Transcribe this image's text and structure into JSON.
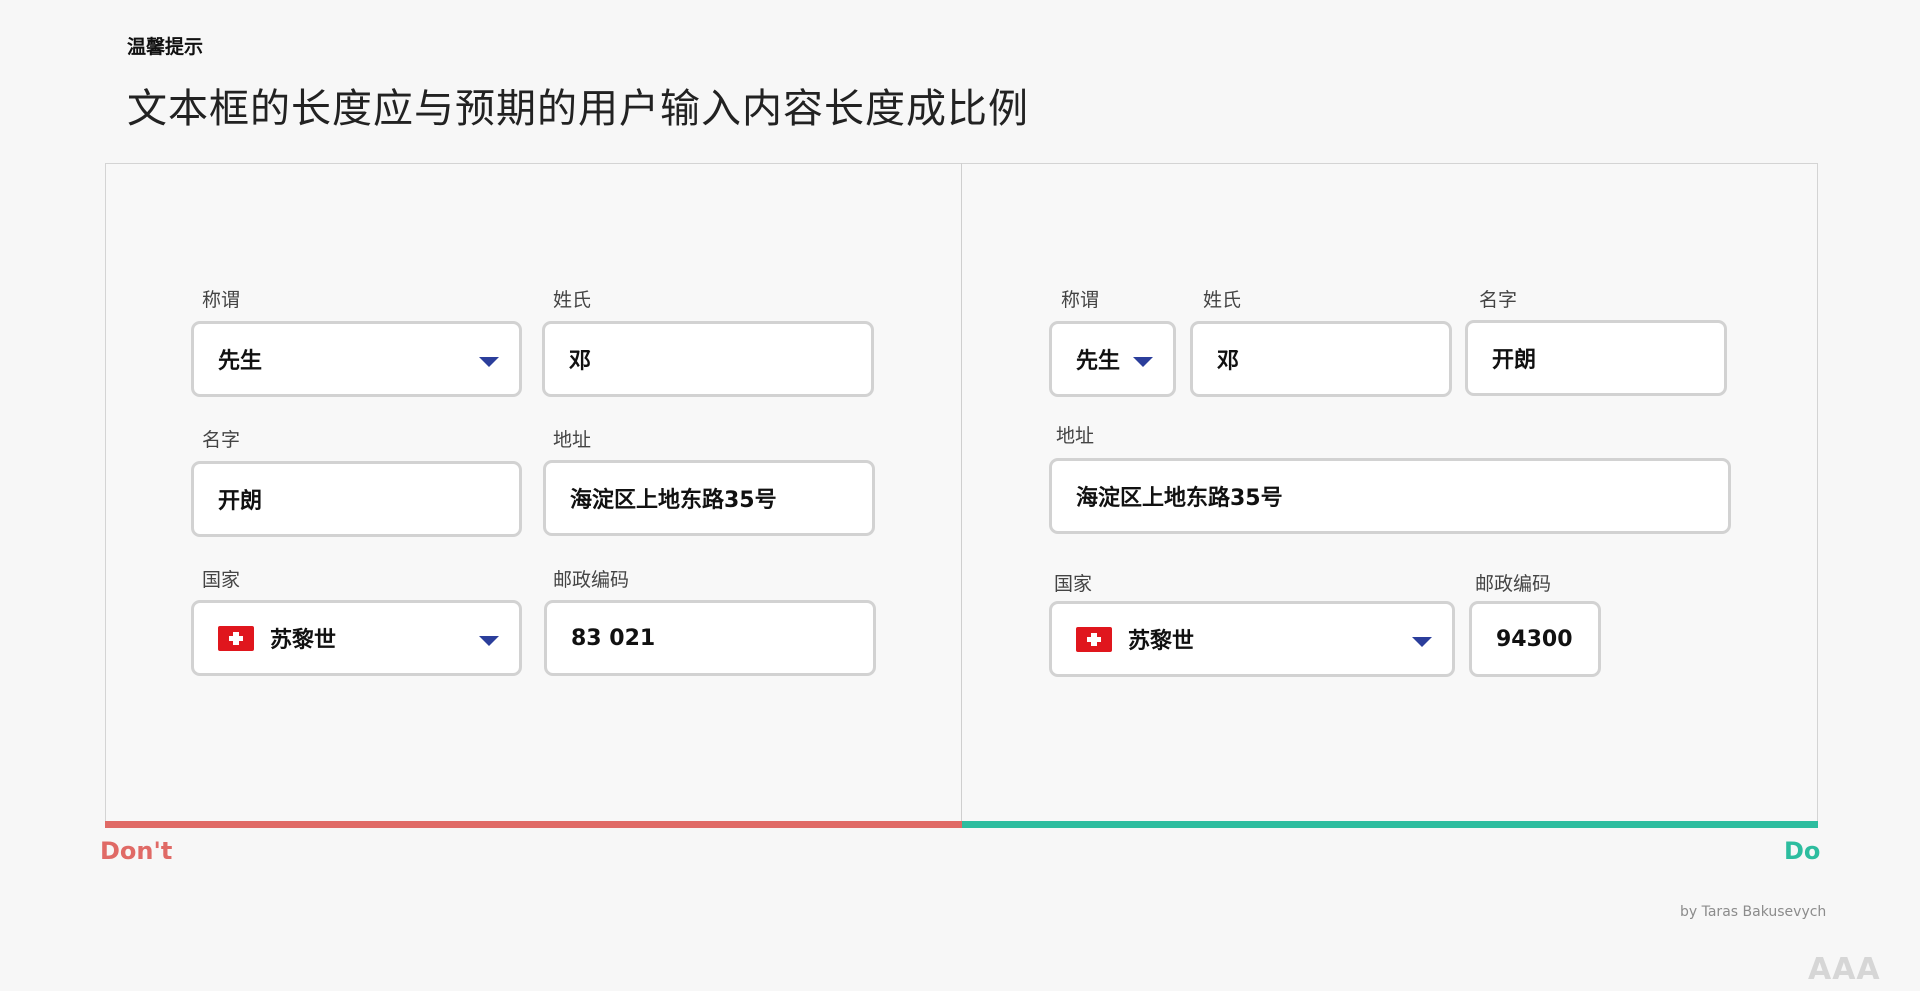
{
  "header": {
    "eyebrow": "温馨提示",
    "title": "文本框的长度应与预期的用户输入内容长度成比例"
  },
  "verdicts": {
    "dont": "Don't",
    "do": "Do"
  },
  "credit": "by Taras Bakusevych",
  "watermark": "AAA",
  "bad_form": {
    "salutation": {
      "label": "称谓",
      "value": "先生",
      "icon": "chevron-down-icon"
    },
    "surname": {
      "label": "姓氏",
      "value": "邓"
    },
    "given_name": {
      "label": "名字",
      "value": "开朗"
    },
    "address": {
      "label": "地址",
      "value": "海淀区上地东路35号"
    },
    "country": {
      "label": "国家",
      "value": "苏黎世",
      "icon": "swiss-flag-icon"
    },
    "postal_code": {
      "label": "邮政编码",
      "value": "83 021"
    }
  },
  "good_form": {
    "salutation": {
      "label": "称谓",
      "value": "先生",
      "icon": "chevron-down-icon"
    },
    "surname": {
      "label": "姓氏",
      "value": "邓"
    },
    "given_name": {
      "label": "名字",
      "value": "开朗"
    },
    "address": {
      "label": "地址",
      "value": "海淀区上地东路35号"
    },
    "country": {
      "label": "国家",
      "value": "苏黎世",
      "icon": "swiss-flag-icon"
    },
    "postal_code": {
      "label": "邮政编码",
      "value": "94300"
    }
  },
  "colors": {
    "dont_accent": "#e06a66",
    "do_accent": "#2dbd9f",
    "caret": "#2b3e9b",
    "flag_red": "#e0161d"
  }
}
